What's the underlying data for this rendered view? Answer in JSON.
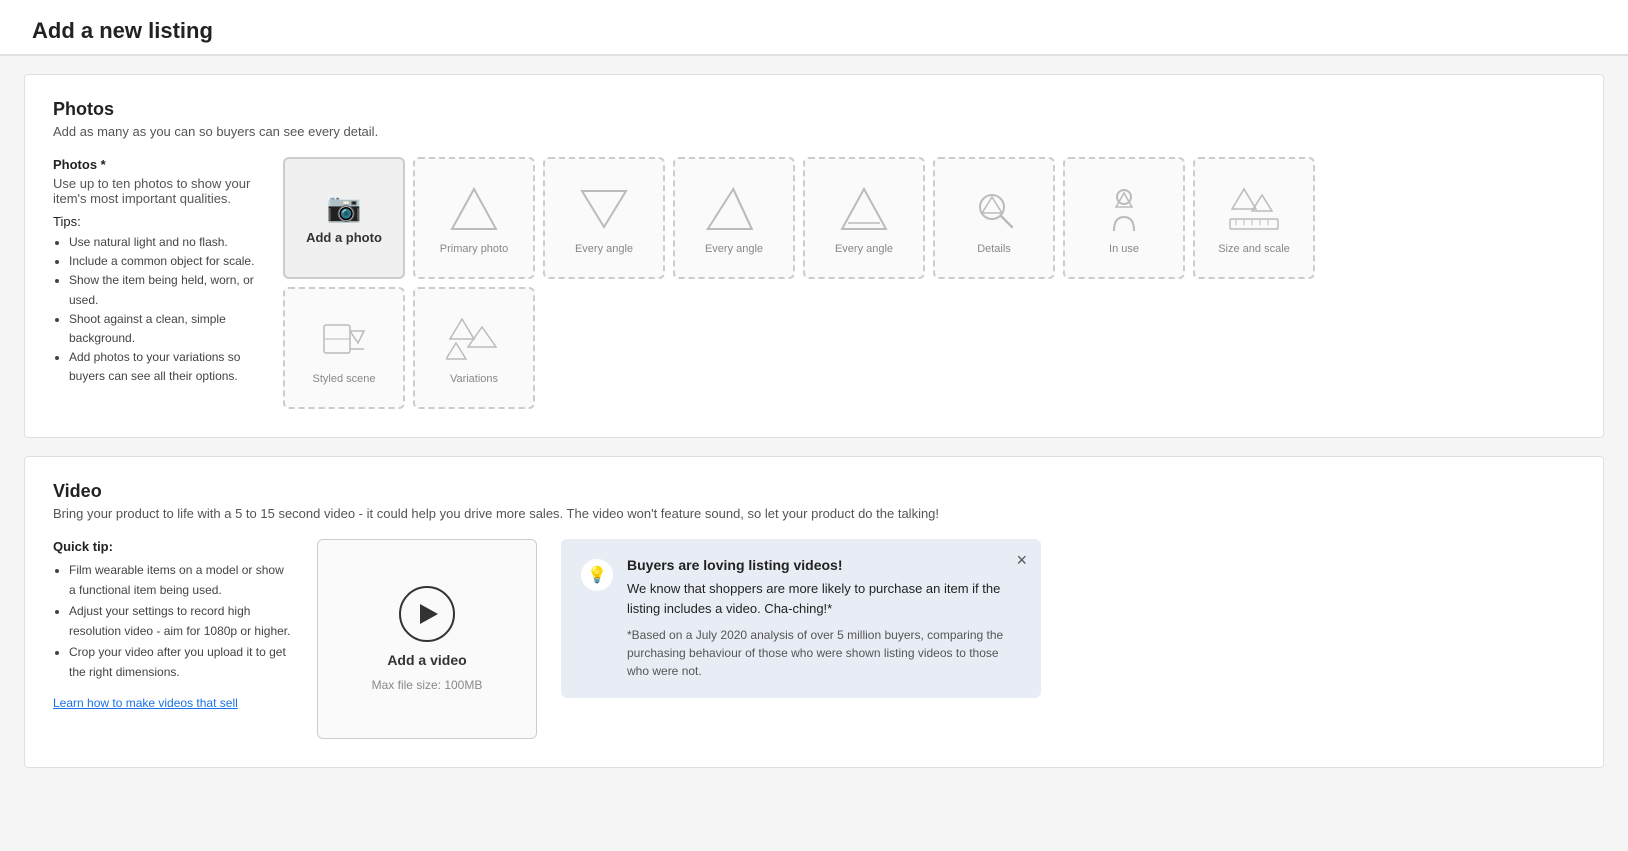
{
  "page": {
    "title": "Add a new listing"
  },
  "photos_section": {
    "title": "Photos",
    "subtitle": "Add as many as you can so buyers can see every detail.",
    "label": "Photos *",
    "description": "Use up to ten photos to show your item's most important qualities.",
    "tips_label": "Tips:",
    "tips": [
      "Use natural light and no flash.",
      "Include a common object for scale.",
      "Show the item being held, worn, or used.",
      "Shoot against a clean, simple background.",
      "Add photos to your variations so buyers can see all their options."
    ],
    "add_photo_label": "Add a photo",
    "slots": [
      {
        "label": "Primary photo",
        "type": "primary"
      },
      {
        "label": "Every angle",
        "type": "angle1"
      },
      {
        "label": "Every angle",
        "type": "angle2"
      },
      {
        "label": "Every angle",
        "type": "angle3"
      },
      {
        "label": "Details",
        "type": "details"
      },
      {
        "label": "In use",
        "type": "inuse"
      },
      {
        "label": "Size and scale",
        "type": "scale"
      },
      {
        "label": "Styled scene",
        "type": "styled"
      },
      {
        "label": "Variations",
        "type": "variations"
      }
    ]
  },
  "video_section": {
    "title": "Video",
    "subtitle": "Bring your product to life with a 5 to 15 second video - it could help you drive more sales. The video won't feature sound, so let your product do the talking!",
    "quick_tip_label": "Quick tip:",
    "tips": [
      "Film wearable items on a model or show a functional item being used.",
      "Adjust your settings to record high resolution video - aim for 1080p or higher.",
      "Crop your video after you upload it to get the right dimensions."
    ],
    "link_text": "Learn how to make videos that sell",
    "upload_label": "Add a video",
    "upload_size": "Max file size: 100MB",
    "promo": {
      "title": "Buyers are loving listing videos!",
      "body": "We know that shoppers are more likely to purchase an item if the listing includes a video. Cha-ching!*",
      "footnote": "*Based on a July 2020 analysis of over 5 million buyers, comparing the purchasing behaviour of those who were shown listing videos to those who were not.",
      "close_label": "×",
      "icon": "💡"
    }
  }
}
